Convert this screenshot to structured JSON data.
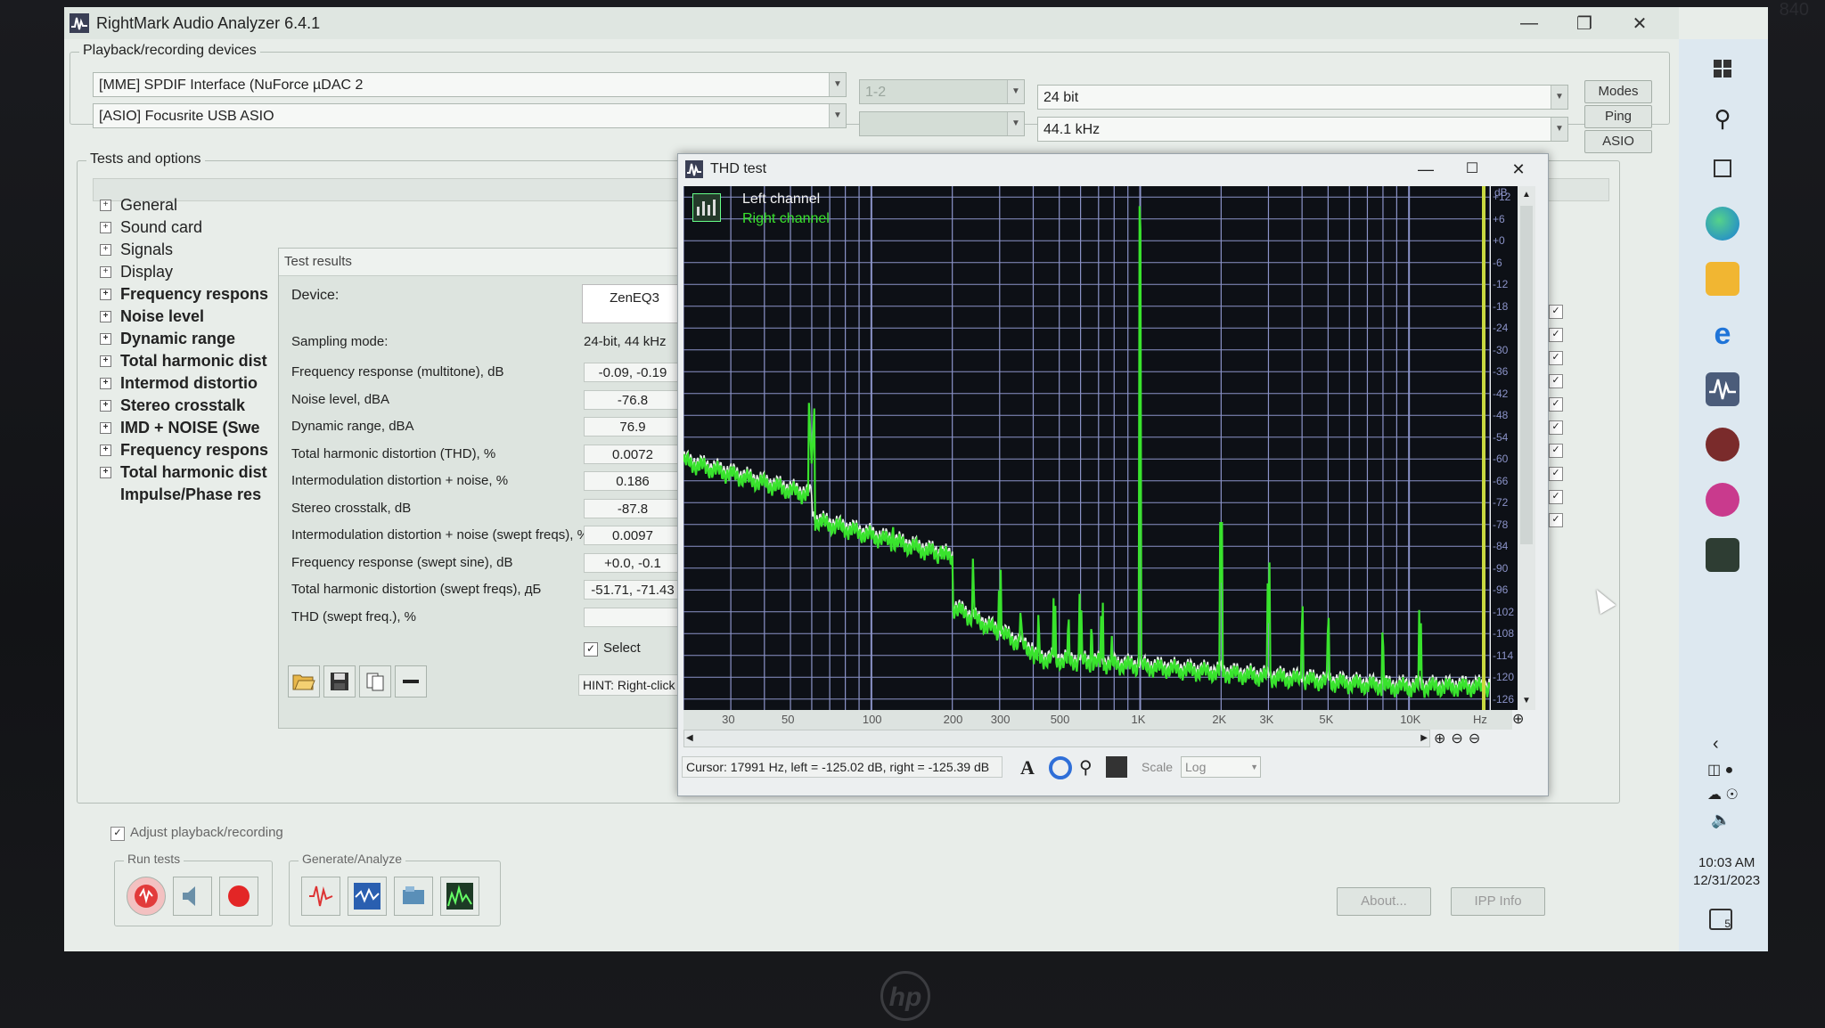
{
  "app": {
    "title": "RightMark Audio Analyzer 6.4.1"
  },
  "devices": {
    "group_label": "Playback/recording devices",
    "playback_device": "[MME] SPDIF Interface (NuForce µDAC 2",
    "recording_device": "[ASIO] Focusrite USB ASIO",
    "channels": "1-2",
    "channels2": "",
    "bit_depth": "24 bit",
    "sample_rate": "44.1 kHz",
    "buttons": {
      "modes": "Modes",
      "ping": "Ping",
      "asio": "ASIO"
    }
  },
  "tests": {
    "group_label": "Tests and options",
    "tree": [
      {
        "label": "General",
        "bold": false
      },
      {
        "label": "Sound card",
        "bold": false
      },
      {
        "label": "Signals",
        "bold": false
      },
      {
        "label": "Display",
        "bold": false
      },
      {
        "label": "Frequency respons",
        "bold": true
      },
      {
        "label": "Noise level",
        "bold": true
      },
      {
        "label": "Dynamic range",
        "bold": true
      },
      {
        "label": "Total harmonic dist",
        "bold": true
      },
      {
        "label": "Intermod distortio",
        "bold": true
      },
      {
        "label": "Stereo crosstalk",
        "bold": true
      },
      {
        "label": "IMD + NOISE (Swe",
        "bold": true
      },
      {
        "label": "Frequency respons",
        "bold": true
      },
      {
        "label": "Total harmonic dist",
        "bold": true
      },
      {
        "label": "Impulse/Phase res",
        "bold": true
      }
    ]
  },
  "results": {
    "title": "Test results",
    "device_label": "Device:",
    "device_value": "ZenEQ3",
    "sampling_label": "Sampling mode:",
    "sampling_value": "24-bit, 44 kHz",
    "rows": [
      {
        "label": "Frequency response (multitone), dB",
        "value": "-0.09, -0.19"
      },
      {
        "label": "Noise level, dBA",
        "value": "-76.8"
      },
      {
        "label": "Dynamic range, dBA",
        "value": "76.9"
      },
      {
        "label": "Total harmonic distortion (THD), %",
        "value": "0.0072"
      },
      {
        "label": "Intermodulation distortion + noise, %",
        "value": "0.186"
      },
      {
        "label": "Stereo crosstalk, dB",
        "value": "-87.8"
      },
      {
        "label": "Intermodulation distortion + noise (swept freqs), %",
        "value": "0.0097"
      },
      {
        "label": "Frequency response (swept sine), dB",
        "value": "+0.0, -0.1"
      },
      {
        "label": "Total harmonic distortion (swept freqs), дБ",
        "value": "-51.71, -71.43"
      },
      {
        "label": "THD (swept freq.), %",
        "value": ""
      }
    ],
    "select_label": "Select",
    "hint": "HINT: Right-click"
  },
  "thd": {
    "title": "THD test",
    "legend_left": "Left channel",
    "legend_right": "Right channel",
    "db_unit": "dB",
    "db_ticks": [
      "+12",
      "+6",
      "+0",
      "-6",
      "-12",
      "-18",
      "-24",
      "-30",
      "-36",
      "-42",
      "-48",
      "-54",
      "-60",
      "-66",
      "-72",
      "-78",
      "-84",
      "-90",
      "-96",
      "-102",
      "-108",
      "-114",
      "-120",
      "-126"
    ],
    "hz_ticks": [
      "30",
      "50",
      "100",
      "200",
      "300",
      "500",
      "1K",
      "2K",
      "3K",
      "5K",
      "10K"
    ],
    "hz_unit": "Hz",
    "cursor_text": "Cursor:  17991 Hz,  left = -125.02 dB,  right = -125.39 dB",
    "scale_label": "Scale",
    "scale_value": "Log"
  },
  "bottom": {
    "adjust_label": "Adjust playback/recording",
    "run_tests_label": "Run tests",
    "generate_label": "Generate/Analyze",
    "about": "About...",
    "ipp": "IPP Info"
  },
  "taskbar": {
    "time": "10:03 AM",
    "date": "12/31/2023",
    "notif_count": "5"
  },
  "laptop": {
    "brand": "hp",
    "top_right": "840"
  },
  "colors": {
    "green": "#39e32d",
    "grid": "#8b93c8",
    "white_trace": "#e6efe6"
  }
}
